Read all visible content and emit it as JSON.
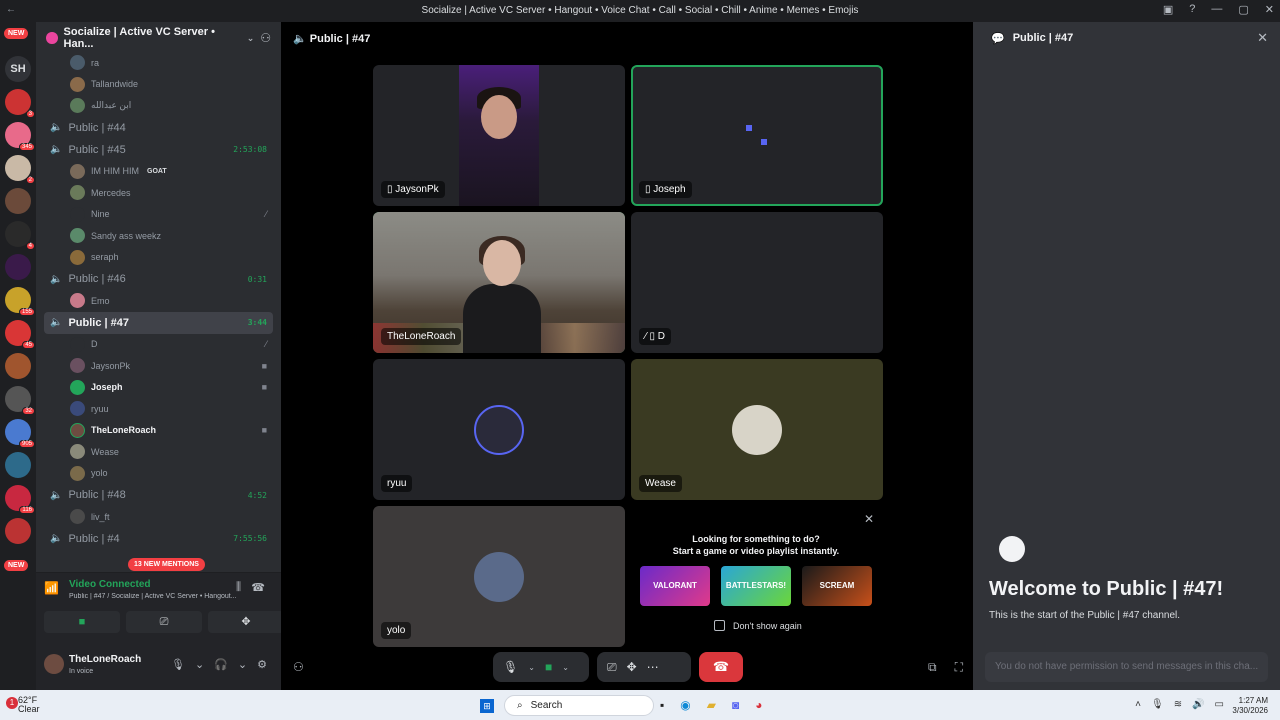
{
  "window": {
    "title": "Socialize | Active VC Server • Hangout • Voice Chat • Call • Social • Chill • Anime • Memes • Emojis"
  },
  "guilds": {
    "new_top": "NEW",
    "new_bottom": "NEW",
    "sh_label": "SH",
    "badges": [
      "3",
      "345",
      "2",
      "4",
      "155",
      "45",
      "32",
      "905",
      "116"
    ]
  },
  "server": {
    "name": "Socialize | Active VC Server • Han..."
  },
  "top_users": [
    {
      "name": "ra"
    },
    {
      "name": "Tallandwide"
    },
    {
      "name": "ابن عبدالله"
    }
  ],
  "ch44": {
    "name": "Public | #44"
  },
  "ch45": {
    "name": "Public | #45",
    "time": "2:53:08",
    "users": [
      "IM HIM HIM",
      "Mercedes",
      "Nine",
      "Sandy ass weekz",
      "seraph"
    ],
    "goat": "GOAT"
  },
  "ch46": {
    "name": "Public | #46",
    "time": "0:31",
    "users": [
      "Emo"
    ]
  },
  "ch47": {
    "name": "Public | #47",
    "time": "3:44",
    "users": [
      "D",
      "JaysonPk",
      "Joseph",
      "ryuu",
      "TheLoneRoach",
      "Wease",
      "yolo"
    ]
  },
  "ch48": {
    "name": "Public | #48",
    "time": "4:52",
    "users": [
      "liv_ft"
    ]
  },
  "ch49": {
    "name": "Public | #4",
    "time": "7:55:56"
  },
  "mentions": "13 NEW MENTIONS",
  "voice": {
    "status": "Video Connected",
    "sub": "Public | #47 / Socialize | Active VC Server • Hangout..."
  },
  "me": {
    "name": "TheLoneRoach",
    "status": "In voice"
  },
  "stage": {
    "title": "Public | #47",
    "tiles": {
      "t1": "JaysonPk",
      "t2": "Joseph",
      "t3": "TheLoneRoach",
      "t4": "D",
      "t5": "ryuu",
      "t6": "Wease",
      "t7": "yolo"
    }
  },
  "suggest": {
    "line1": "Looking for something to do?",
    "line2": "Start a game or video playlist instantly.",
    "dont_show": "Don't show again",
    "activities": [
      "VALORANT",
      "BATTLESTARS!",
      "SCREAM"
    ]
  },
  "chat": {
    "title": "Public | #47",
    "welcome": "Welcome to Public | #47!",
    "welcome_sub": "This is the start of the Public | #47 channel.",
    "noperm": "You do not have permission to send messages in this cha..."
  },
  "taskbar": {
    "weather_temp": "62°F",
    "weather_desc": "Clear",
    "search": "Search",
    "time": "1:27 AM",
    "date": "3/30/2026"
  },
  "colors": {
    "online_green": "#23a55a",
    "hangup_red": "#da373c",
    "mention_red": "#f23f43",
    "blurple": "#5865f2"
  }
}
